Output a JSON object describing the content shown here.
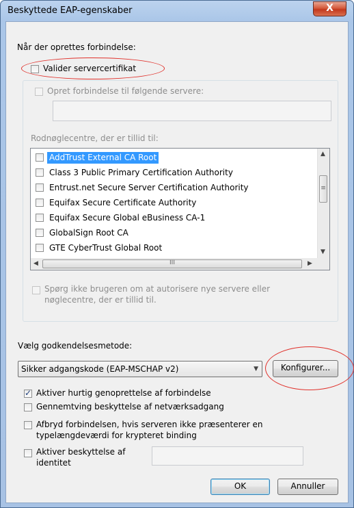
{
  "window": {
    "title": "Beskyttede EAP-egenskaber",
    "close_glyph": "X"
  },
  "connect_section": {
    "heading": "Når der oprettes forbindelse:",
    "validate_cert_label": "Valider servercertifikat",
    "validate_cert_checked": false,
    "connect_servers_label": "Opret forbindelse til følgende servere:",
    "connect_servers_checked": false,
    "servers_value": "",
    "trusted_ca_heading": "Rodnøglecentre, der er tillid til:",
    "ca_list": [
      {
        "label": "AddTrust External CA Root",
        "checked": false,
        "selected": true
      },
      {
        "label": "Class 3 Public Primary Certification Authority",
        "checked": false,
        "selected": false
      },
      {
        "label": "Entrust.net Secure Server Certification Authority",
        "checked": false,
        "selected": false
      },
      {
        "label": "Equifax Secure Certificate Authority",
        "checked": false,
        "selected": false
      },
      {
        "label": "Equifax Secure Global eBusiness CA-1",
        "checked": false,
        "selected": false
      },
      {
        "label": "GlobalSign Root CA",
        "checked": false,
        "selected": false
      },
      {
        "label": "GTE CyberTrust Global Root",
        "checked": false,
        "selected": false
      }
    ],
    "prompt_user_label_line1": "Spørg ikke brugeren om at autorisere nye servere eller",
    "prompt_user_label_line2": "nøglecentre, der er tillid til.",
    "prompt_user_checked": false
  },
  "auth_section": {
    "heading": "Vælg godkendelsesmetode:",
    "method_selected": "Sikker adgangskode (EAP-MSCHAP v2)",
    "configure_label": "Konfigurer...",
    "fast_reconnect_label": "Aktiver hurtig genoprettelse af forbindelse",
    "fast_reconnect_checked": true,
    "nap_label": "Gennemtving beskyttelse af netværksadgang",
    "nap_checked": false,
    "disconnect_label_line1": "Afbryd forbindelsen, hvis serveren ikke præsenterer en",
    "disconnect_label_line2": "typelængdeværdi for krypteret binding",
    "disconnect_checked": false,
    "identity_label_line1": "Aktiver beskyttelse af",
    "identity_label_line2": "identitet",
    "identity_checked": false,
    "identity_value": ""
  },
  "buttons": {
    "ok": "OK",
    "cancel": "Annuller"
  },
  "scroll_glyphs": {
    "up": "▲",
    "down": "▼",
    "left": "◀",
    "right": "▶",
    "grip_v": "≡",
    "grip_h": "III",
    "dropdown": "▼"
  },
  "colors": {
    "selection": "#3399ff",
    "annotation_red": "#e0302a",
    "close_button": "#c3391d"
  }
}
